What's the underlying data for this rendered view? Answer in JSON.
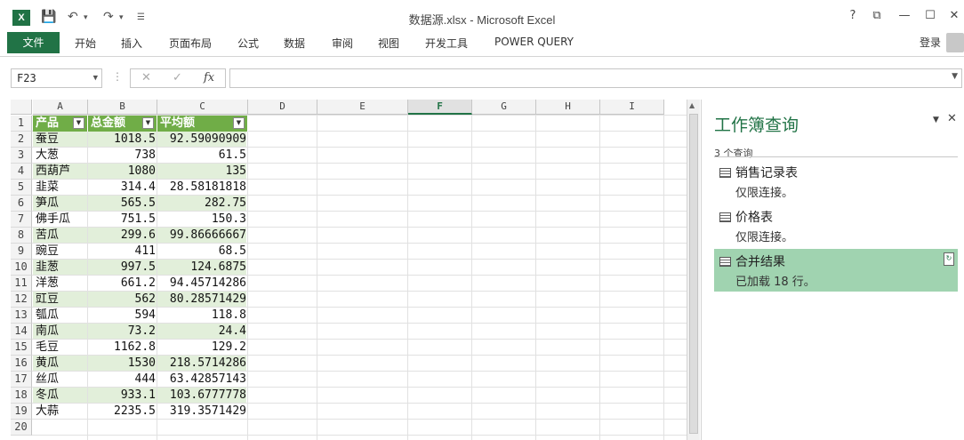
{
  "window": {
    "title": "数据源.xlsx - Microsoft Excel",
    "app_icon": "X",
    "controls": [
      "?",
      "⧉",
      "—",
      "☐",
      "✕"
    ]
  },
  "ribbon": {
    "file_tab": "文件",
    "tabs": [
      "开始",
      "插入",
      "页面布局",
      "公式",
      "数据",
      "审阅",
      "视图",
      "开发工具",
      "POWER QUERY"
    ],
    "login": "登录"
  },
  "formula_bar": {
    "name_box": "F23",
    "formula": ""
  },
  "grid": {
    "columns": [
      "A",
      "B",
      "C",
      "D",
      "E",
      "F",
      "G",
      "H",
      "I"
    ],
    "selected_column": "F",
    "rows": [
      "1",
      "2",
      "3",
      "4",
      "5",
      "6",
      "7",
      "8",
      "9",
      "10",
      "11",
      "12",
      "13",
      "14",
      "15",
      "16",
      "17",
      "18",
      "19",
      "20"
    ],
    "table_header": [
      "产品",
      "总金额",
      "平均额"
    ],
    "table_rows": [
      [
        "蚕豆",
        "1018.5",
        "92.59090909"
      ],
      [
        "大葱",
        "738",
        "61.5"
      ],
      [
        "西葫芦",
        "1080",
        "135"
      ],
      [
        "韭菜",
        "314.4",
        "28.58181818"
      ],
      [
        "笋瓜",
        "565.5",
        "282.75"
      ],
      [
        "佛手瓜",
        "751.5",
        "150.3"
      ],
      [
        "苦瓜",
        "299.6",
        "99.86666667"
      ],
      [
        "豌豆",
        "411",
        "68.5"
      ],
      [
        "韭葱",
        "997.5",
        "124.6875"
      ],
      [
        "洋葱",
        "661.2",
        "94.45714286"
      ],
      [
        "豇豆",
        "562",
        "80.28571429"
      ],
      [
        "瓠瓜",
        "594",
        "118.8"
      ],
      [
        "南瓜",
        "73.2",
        "24.4"
      ],
      [
        "毛豆",
        "1162.8",
        "129.2"
      ],
      [
        "黄瓜",
        "1530",
        "218.5714286"
      ],
      [
        "丝瓜",
        "444",
        "63.42857143"
      ],
      [
        "冬瓜",
        "933.1",
        "103.6777778"
      ],
      [
        "大蒜",
        "2235.5",
        "319.3571429"
      ]
    ]
  },
  "query_pane": {
    "title": "工作簿查询",
    "count": "3 个查询",
    "queries": [
      {
        "name": "销售记录表",
        "status": "仅限连接。"
      },
      {
        "name": "价格表",
        "status": "仅限连接。"
      },
      {
        "name": "合并结果",
        "status": "已加载 18 行。"
      }
    ],
    "accent_color": "#217346",
    "active_bg": "#a0d3b0"
  }
}
